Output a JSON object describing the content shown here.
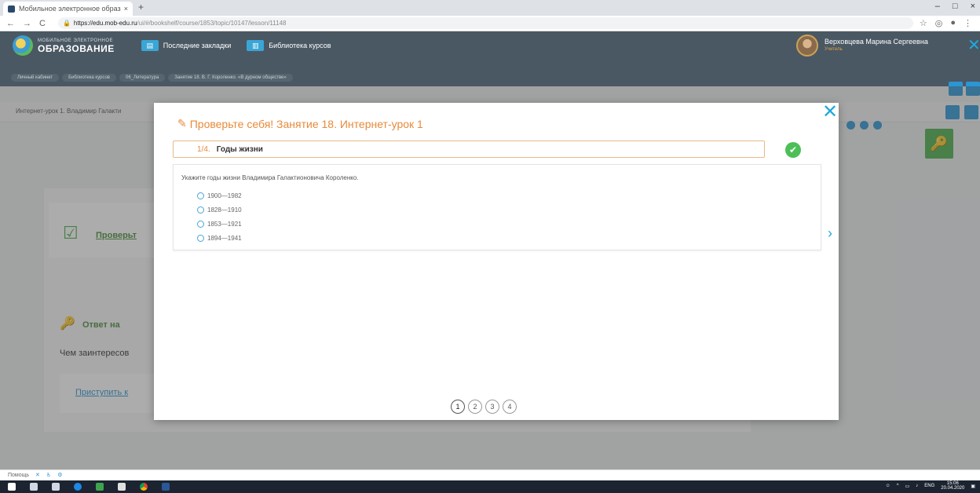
{
  "browser": {
    "tab_title": "Мобильное электронное образ",
    "tab_close": "×",
    "new_tab": "+",
    "url_host": "https://edu.mob-edu.ru",
    "url_path": "/ui/#/bookshelf/course/1853/topic/10147/lesson/11148",
    "win_minimize": "–",
    "win_maximize": "□",
    "win_close": "×"
  },
  "site": {
    "logo_small": "МОБИЛЬНОЕ ЭЛЕКТРОННОЕ",
    "logo_big": "ОБРАЗОВАНИЕ",
    "link_bookmarks": "Последние закладки",
    "link_library": "Библиотека курсов",
    "user_name": "Верховцева Марина Сергеевна",
    "user_role": "Учитель",
    "breadcrumbs": [
      "Личный кабинет",
      "Библиотека курсов",
      "06_Литература",
      "Занятие 18. В. Г. Короленко. «В дурном обществе»"
    ]
  },
  "page": {
    "lesson_title": "Интернет-урок 1. Владимир Галакти",
    "check_link": "Проверьт",
    "answer_section": "Ответ на",
    "question2": "Чем заинтересов",
    "start_link": "Приступить к",
    "footer_text": "Помощь"
  },
  "modal": {
    "title": "Проверьте себя! Занятие 18. Интернет-урок 1",
    "question_number": "1/4.",
    "question_title": "Годы жизни",
    "question_text": "Укажите годы жизни Владимира Галактионовича Короленко.",
    "options": [
      "1900—1982",
      "1828—1910",
      "1853—1921",
      "1894—1941"
    ],
    "pages": [
      "1",
      "2",
      "3",
      "4"
    ],
    "active_page": "1"
  },
  "taskbar": {
    "lang": "ENG",
    "time": "15:06",
    "date": "20.04.2020"
  }
}
